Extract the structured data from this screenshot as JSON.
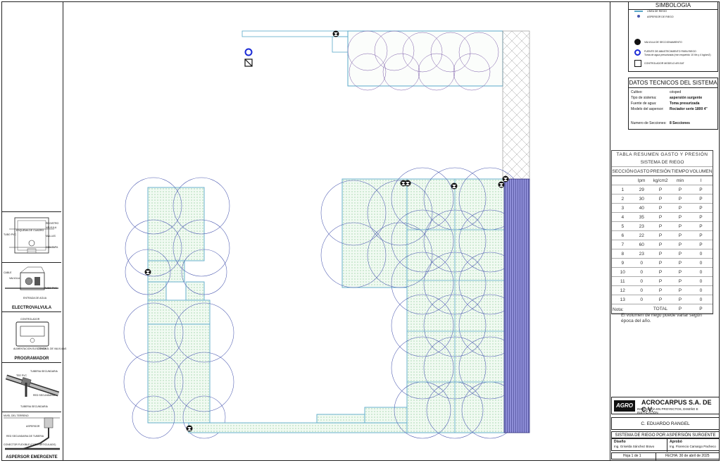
{
  "simbologia": {
    "title": "SIMBOLOGIA",
    "items": [
      {
        "label": "LÍNEA DE RIEGO",
        "icon": "line-icon"
      },
      {
        "label": "ASPERSOR DE RIEGO",
        "icon": "sprinkler-dot-icon"
      },
      {
        "label": "VALVULA DE SECCIONAMIENTO",
        "icon": "valve-icon"
      },
      {
        "label": "FUENTE DE ABASTECIMIENTO PARA RIEGO",
        "icon": "water-source-icon"
      },
      {
        "label": "Toma de agua presurizada (mín requerido 10 lt/s y 4 kg/cm2)",
        "icon": ""
      },
      {
        "label": "CONTROLADOR MODELO AR-SAT",
        "icon": "controller-icon"
      }
    ]
  },
  "datos": {
    "title": "DATOS TECNICOS DEL SISTEMA",
    "rows": [
      {
        "label": "Cultivo:",
        "value": "césped"
      },
      {
        "label": "Tipo de sistema:",
        "value": "aspersión surgente"
      },
      {
        "label": "Fuente de agua:",
        "value": "Toma presurizada"
      },
      {
        "label": "Modelo del aspersor:",
        "value": "Rociador serie 1800 4\""
      },
      {
        "label": "Numero de Secciones:",
        "value": "8 Secciones"
      }
    ]
  },
  "tabla": {
    "title_1": "TABLA RESUMEN GASTO Y PRESIÓN",
    "title_2": "SISTEMA DE RIEGO",
    "headers": [
      "SECCIÓN",
      "GASTO",
      "PRESIÓN",
      "TIEMPO",
      "VOLUMEN"
    ],
    "units": [
      "",
      "lpm",
      "kg/cm2",
      "min",
      "l"
    ],
    "rows": [
      [
        "1",
        "29",
        "P",
        "P",
        "P"
      ],
      [
        "2",
        "30",
        "P",
        "P",
        "P"
      ],
      [
        "3",
        "40",
        "P",
        "P",
        "P"
      ],
      [
        "4",
        "35",
        "P",
        "P",
        "P"
      ],
      [
        "5",
        "23",
        "P",
        "P",
        "P"
      ],
      [
        "6",
        "22",
        "P",
        "P",
        "P"
      ],
      [
        "7",
        "60",
        "P",
        "P",
        "P"
      ],
      [
        "8",
        "23",
        "P",
        "P",
        "0"
      ],
      [
        "9",
        "0",
        "P",
        "P",
        "0"
      ],
      [
        "10",
        "0",
        "P",
        "P",
        "0"
      ],
      [
        "11",
        "0",
        "P",
        "P",
        "0"
      ],
      [
        "12",
        "0",
        "P",
        "P",
        "0"
      ],
      [
        "13",
        "0",
        "P",
        "P",
        "0"
      ]
    ],
    "total_label": "TOTAL",
    "total_values": [
      "P",
      "P"
    ]
  },
  "note": {
    "label": "Nota:",
    "text": "El volumen de riego puede variar según época del año."
  },
  "company": {
    "logo": "AGRO",
    "name": "ACROCARPUS S.A. DE C.V.",
    "subtitle": "INGENIERÍA EN PROYECTOS, DISEÑO E INSTALACIÓN"
  },
  "client": "C. EDUARDO RANGEL",
  "project": "SISTEMA DE RIEGO POR ASPERSIÓN SURGENTE",
  "design": {
    "label": "Diseño",
    "name": "Ing. Griselda Sánchez Bravo"
  },
  "approved": {
    "label": "Aprobó",
    "name": "Ing. Florencio Camargo Pacheco"
  },
  "sheet": "Hoja 1 de 1",
  "date": "FECHA: 30 de abril de 2025",
  "details": [
    {
      "caption": "",
      "labels": [
        "REGISTRO",
        "CON TAPA",
        "ESQUEMA DE CUADRO",
        "MALLAS",
        "VALVULA",
        "FIRMAL",
        "CAPA DE GRAVA",
        "TUBO PVC"
      ]
    },
    {
      "caption": "ELECTROVALVULA",
      "labels": [
        "CABLE",
        "VALVULA",
        "CONEXION DE CONTROL",
        "TUBO PVC",
        "ENTRADA DE AGUA"
      ]
    },
    {
      "caption": "PROGRAMADOR",
      "labels": [
        "CONTROLADOR",
        "ALIMENTACION ELECTRICA",
        "CONTROL DE VALVULAS"
      ]
    },
    {
      "caption": "",
      "labels": [
        "TUBERIA SECUNDARIA",
        "TEE PVC",
        "RED SECUNDARIA",
        "TUBERIA SECUNDARIA"
      ]
    },
    {
      "caption": "ASPERSOR EMERGENTE",
      "labels": [
        "NIVEL DEL TERRENO",
        "ASPERSOR",
        "RED SECUNDARIA DE TUBERIA",
        "CONECTOR FLEXIBLE (CODO ARTICULADO)"
      ]
    }
  ],
  "colors": {
    "pipe": "#5aa9c9",
    "circle": "#4a58b0",
    "fill": "#d8f0dc",
    "hatch": "#3a3a8a",
    "source": "#1a2ad6"
  }
}
